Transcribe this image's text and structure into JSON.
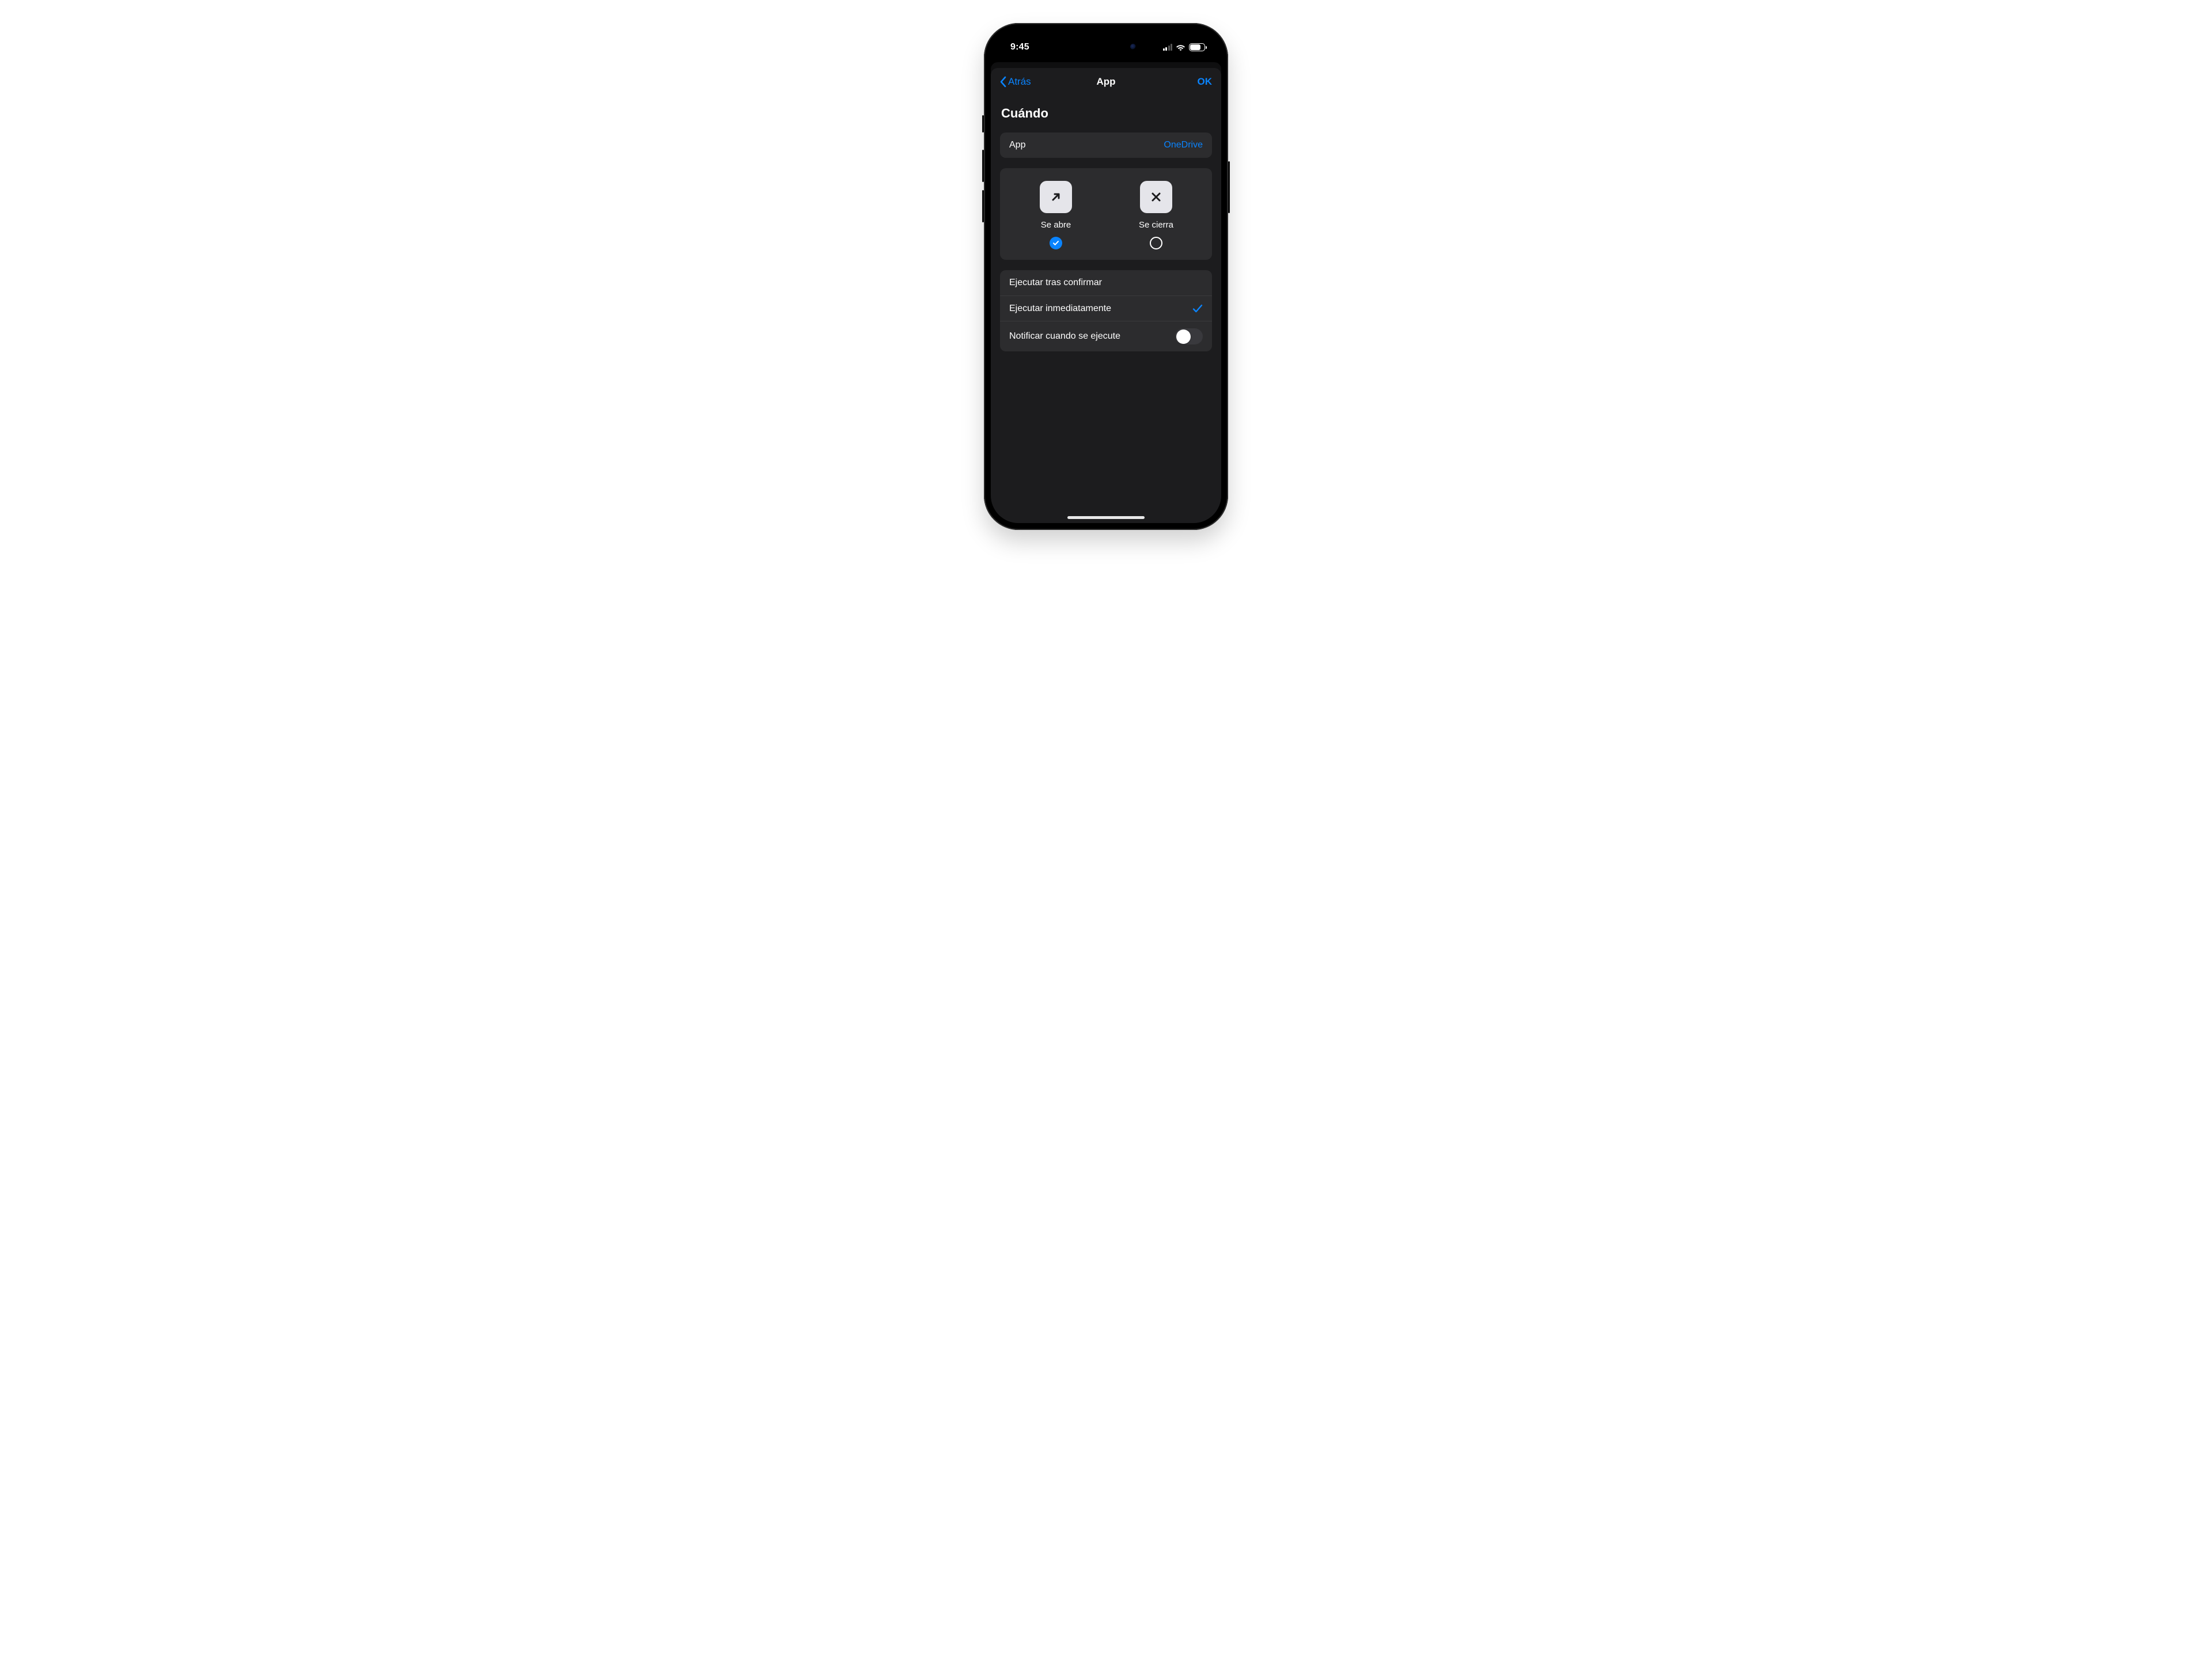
{
  "status": {
    "time": "9:45",
    "battery_pct": "73",
    "battery_fill_pct": 73
  },
  "nav": {
    "back_label": "Atrás",
    "title": "App",
    "ok_label": "OK"
  },
  "section": {
    "title": "Cuándo"
  },
  "app_row": {
    "label": "App",
    "value": "OneDrive"
  },
  "triggers": {
    "open": {
      "label": "Se abre",
      "selected": true
    },
    "close": {
      "label": "Se cierra",
      "selected": false
    }
  },
  "run": {
    "confirm_label": "Ejecutar tras confirmar",
    "immediate_label": "Ejecutar inmediatamente",
    "immediate_selected": true,
    "notify_label": "Notificar cuando se ejecute",
    "notify_on": false
  }
}
